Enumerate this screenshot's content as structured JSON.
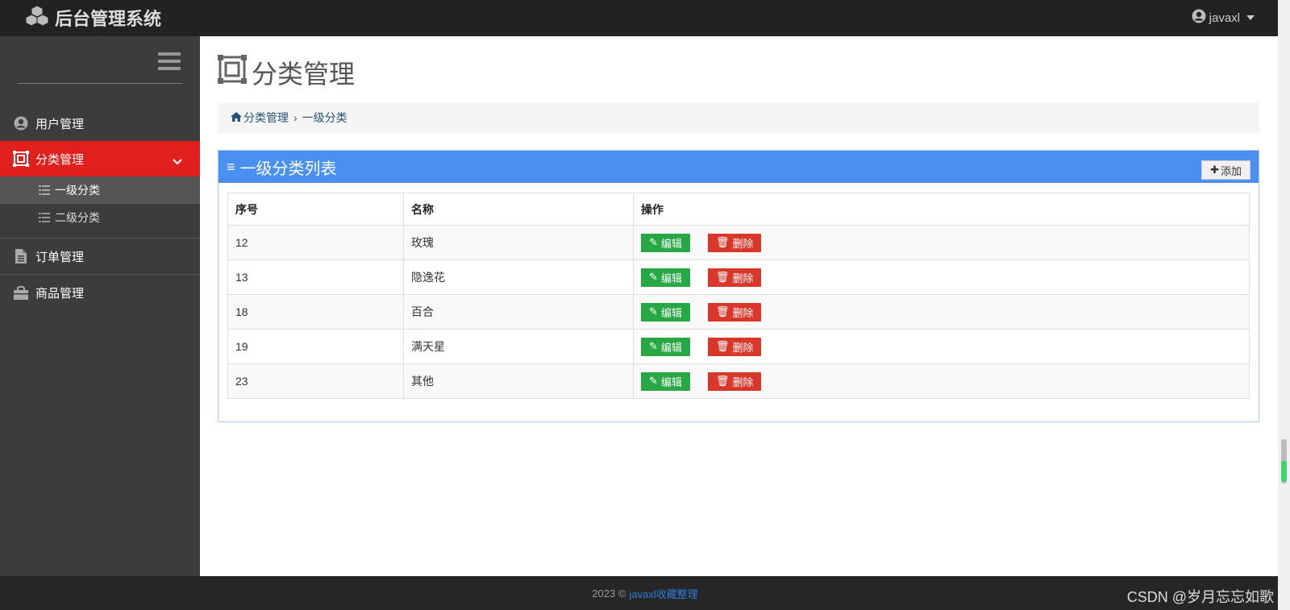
{
  "header": {
    "title": "后台管理系统",
    "username": "javaxl"
  },
  "sidebar": {
    "items": [
      {
        "label": "用户管理",
        "icon": "user-circle-icon"
      },
      {
        "label": "分类管理",
        "icon": "category-frame-icon",
        "active": true,
        "children": [
          {
            "label": "一级分类",
            "active": true
          },
          {
            "label": "二级分类"
          }
        ]
      },
      {
        "label": "订单管理",
        "icon": "document-icon"
      },
      {
        "label": "商品管理",
        "icon": "shopping-bag-icon"
      }
    ]
  },
  "page": {
    "title": "分类管理",
    "breadcrumb": {
      "root": "分类管理",
      "current": "一级分类"
    }
  },
  "panel": {
    "title": "一级分类列表",
    "add_label": "添加"
  },
  "table": {
    "headers": [
      "序号",
      "名称",
      "操作"
    ],
    "rows": [
      {
        "id": "12",
        "name": "玫瑰"
      },
      {
        "id": "13",
        "name": "隐逸花"
      },
      {
        "id": "18",
        "name": "百合"
      },
      {
        "id": "19",
        "name": "满天星"
      },
      {
        "id": "23",
        "name": "其他"
      }
    ],
    "edit_label": "编辑",
    "delete_label": "删除"
  },
  "footer": {
    "copyright": "2023 ©",
    "link": "javaxl收藏整理"
  },
  "watermark": "CSDN @岁月忘忘如歌",
  "colors": {
    "topbar": "#222222",
    "sidebar": "#3c3c3c",
    "active_nav": "#e1201d",
    "panel_header": "#4a8ff2",
    "edit_button": "#28a745",
    "delete_button": "#d9372a"
  }
}
